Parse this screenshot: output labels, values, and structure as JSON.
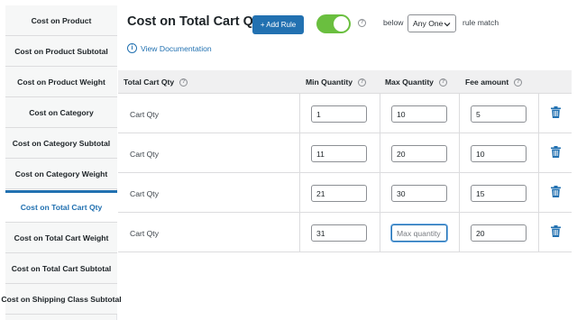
{
  "sidebar": {
    "items": [
      {
        "label": "Cost on Product",
        "active": false
      },
      {
        "label": "Cost on Product Subtotal",
        "active": false
      },
      {
        "label": "Cost on Product Weight",
        "active": false
      },
      {
        "label": "Cost on Category",
        "active": false
      },
      {
        "label": "Cost on Category Subtotal",
        "active": false
      },
      {
        "label": "Cost on Category Weight",
        "active": false
      },
      {
        "label": "Cost on Total Cart Qty",
        "active": true
      },
      {
        "label": "Cost on Total Cart Weight",
        "active": false
      },
      {
        "label": "Cost on Total Cart Subtotal",
        "active": false
      },
      {
        "label": "Cost on Shipping Class Subtotal",
        "active": false
      }
    ]
  },
  "header": {
    "title": "Cost on Total Cart Qty",
    "add_rule_label": "+ Add Rule",
    "toggle_on": true,
    "below_label": "below",
    "match_select_value": "Any One",
    "rule_match_label": "rule match",
    "doc_link_label": "View Documentation"
  },
  "table": {
    "columns": [
      "Total Cart Qty",
      "Min Quantity",
      "Max Quantity",
      "Fee amount"
    ],
    "rows": [
      {
        "label": "Cart Qty",
        "min": "1",
        "max": "10",
        "fee": "5"
      },
      {
        "label": "Cart Qty",
        "min": "11",
        "max": "20",
        "fee": "10"
      },
      {
        "label": "Cart Qty",
        "min": "21",
        "max": "30",
        "fee": "15"
      },
      {
        "label": "Cart Qty",
        "min": "31",
        "max": "",
        "max_placeholder": "Max quantity",
        "fee": "20"
      }
    ]
  },
  "colors": {
    "accent": "#2271b1",
    "toggle_on": "#6abf3f",
    "trash": "#2271b1"
  },
  "icons": {
    "help": "question-circle-icon",
    "info": "info-circle-icon",
    "delete": "trash-icon",
    "select": "chevron-down-icon"
  }
}
